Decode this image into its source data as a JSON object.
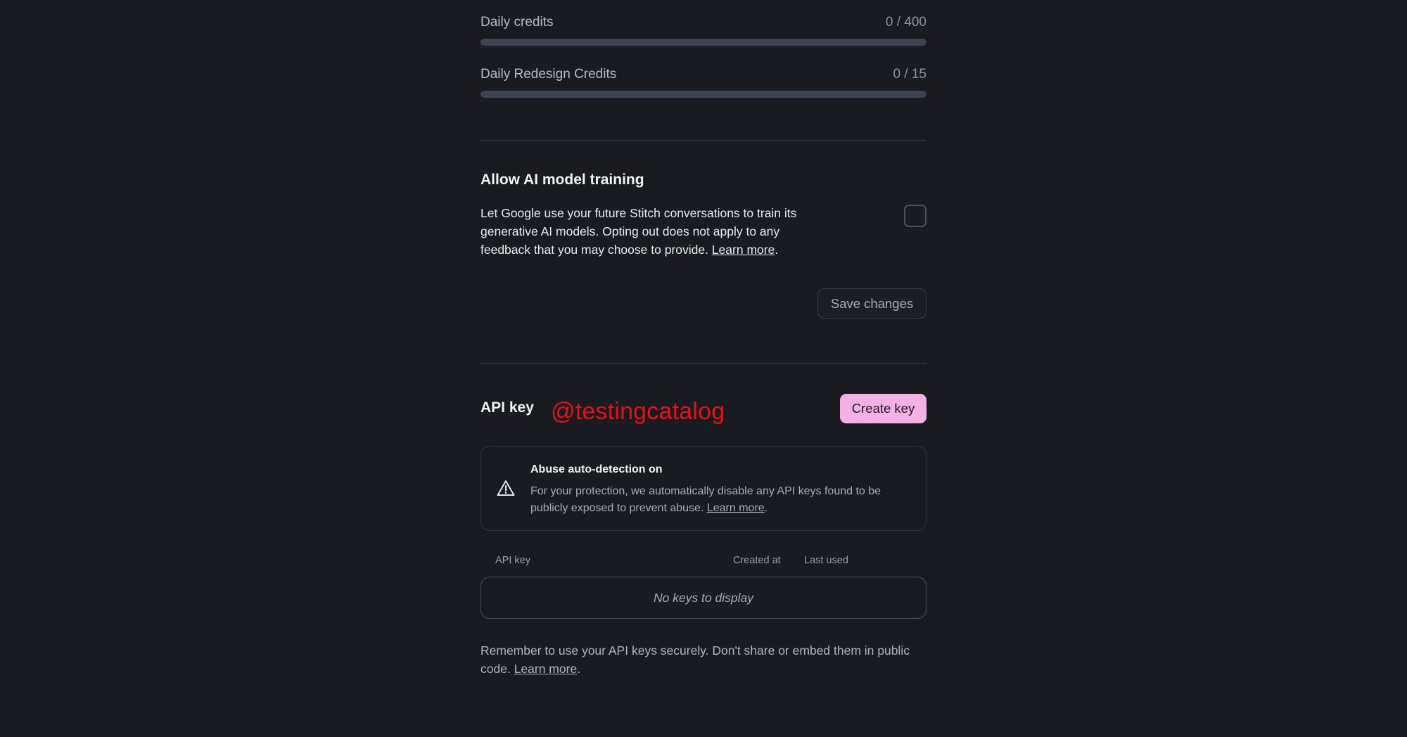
{
  "credits": [
    {
      "label": "Daily credits",
      "value": "0 / 400",
      "used_fraction": 0
    },
    {
      "label": "Daily Redesign Credits",
      "value": "0 / 15",
      "used_fraction": 0
    }
  ],
  "training": {
    "title": "Allow AI model training",
    "description": "Let Google use your future Stitch conversations to train its generative AI models. Opting out does not apply to any feedback that you may choose to provide.",
    "learn_more": "Learn more",
    "end_punct": ".",
    "checked": false,
    "save_label": "Save changes"
  },
  "api": {
    "title": "API key",
    "watermark": "@testingcatalog",
    "create_label": "Create key",
    "abuse": {
      "title": "Abuse auto-detection on",
      "text": "For your protection, we automatically disable any API keys found to be publicly exposed to prevent abuse.",
      "learn_more": "Learn more",
      "end_punct": ".",
      "icon": "warning-triangle-icon"
    },
    "table": {
      "columns": [
        "API key",
        "Created at",
        "Last used"
      ],
      "empty_text": "No keys to display"
    },
    "note": "Remember to use your API keys securely. Don't share or embed them in public code.",
    "note_learn_more": "Learn more",
    "note_end_punct": "."
  }
}
